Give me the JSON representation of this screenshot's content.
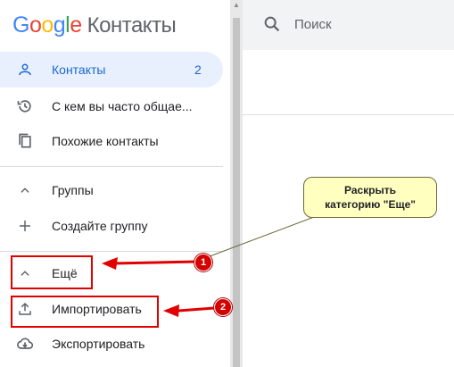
{
  "header": {
    "logo": {
      "google": [
        "G",
        "o",
        "o",
        "g",
        "l",
        "e"
      ],
      "product": "Контакты"
    },
    "search": {
      "placeholder": "Поиск"
    }
  },
  "sidebar": {
    "items": [
      {
        "label": "Контакты",
        "count": "2",
        "icon": "person-icon",
        "active": true
      },
      {
        "label": "С кем вы часто общае...",
        "icon": "history-icon"
      },
      {
        "label": "Похожие контакты",
        "icon": "copy-icon"
      },
      {
        "label": "Группы",
        "icon": "chevron-up-icon"
      },
      {
        "label": "Создайте группу",
        "icon": "plus-icon"
      },
      {
        "label": "Ещё",
        "icon": "chevron-up-icon"
      },
      {
        "label": "Импортировать",
        "icon": "upload-icon"
      },
      {
        "label": "Экспортировать",
        "icon": "cloud-download-icon"
      }
    ]
  },
  "annotations": {
    "callout": {
      "line1": "Раскрыть",
      "line2": "категорию \"Еще\""
    },
    "badge1": "1",
    "badge2": "2"
  },
  "colors": {
    "accent": "#1967d2",
    "active_bg": "#e8f0fe",
    "annotation_red": "#e00000",
    "callout_bg": "#ffffc0"
  }
}
